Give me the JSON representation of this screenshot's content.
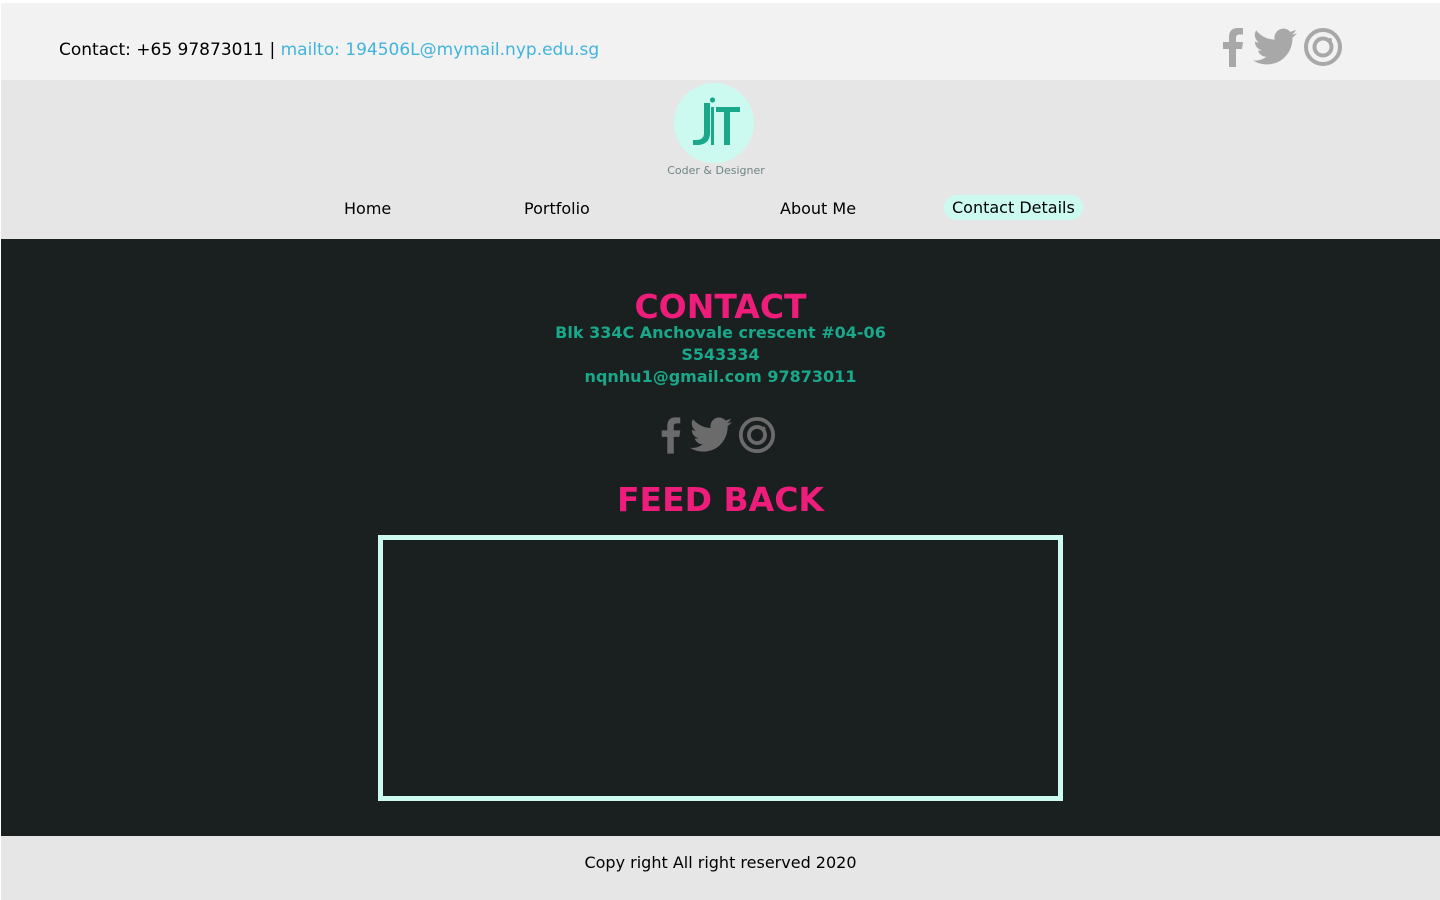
{
  "topbar": {
    "contact_prefix": "Contact: +65 97873011 | ",
    "email_link": "mailto: 194506L@mymail.nyp.edu.sg",
    "social_icons": [
      "facebook-icon",
      "twitter-icon",
      "instagram-icon"
    ]
  },
  "header": {
    "logo_text": "JIT",
    "tagline": "Coder & Designer",
    "nav": {
      "home": "Home",
      "portfolio": "Portfolio",
      "about": "About Me",
      "contact": "Contact Details"
    },
    "active_nav": "Contact Details"
  },
  "main": {
    "contact_heading": "CONTACT",
    "address_line1": "Blk 334C Anchovale crescent #04-06",
    "address_line2": "S543334",
    "email_phone": "nqnhu1@gmail.com 97873011",
    "social_icons": [
      "facebook-icon",
      "twitter-icon",
      "instagram-icon"
    ],
    "feedback_heading": "FEED BACK",
    "feedback_value": ""
  },
  "footer": {
    "copyright": "Copy right All right reserved 2020"
  },
  "colors": {
    "accent_pink": "#ee1d7c",
    "accent_teal": "#1aa88a",
    "mint": "#ccfaf0",
    "link_blue": "#42b4dc",
    "icon_gray_light": "#a8a8a8",
    "icon_gray_dark": "#6b6b6b",
    "dark_bg": "#1a1f1f"
  }
}
